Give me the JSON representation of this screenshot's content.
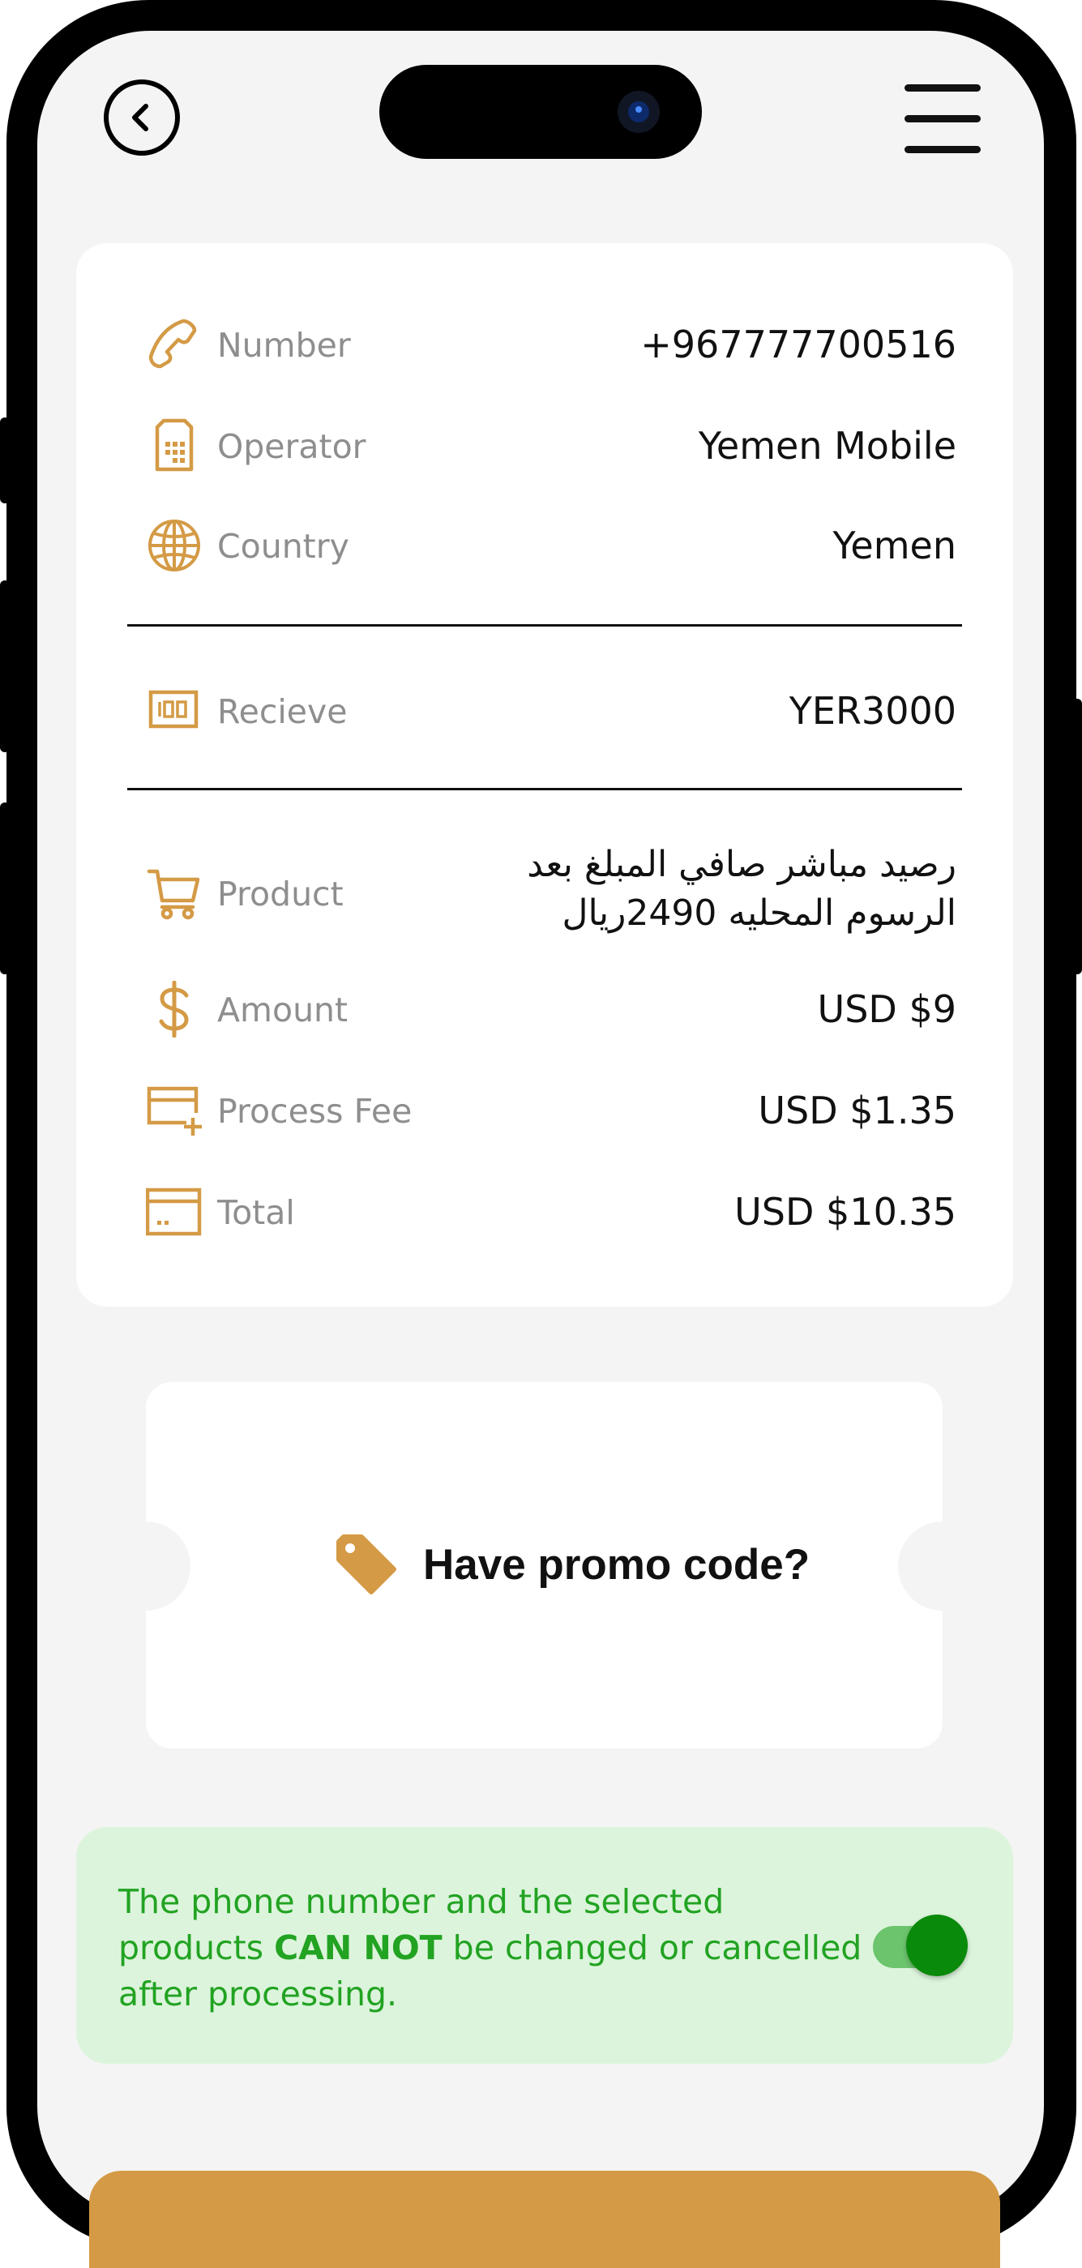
{
  "details": [
    {
      "icon": "phone-icon",
      "label": "Number",
      "value": "+967777700516"
    },
    {
      "icon": "sim-card-icon",
      "label": "Operator",
      "value": "Yemen Mobile"
    },
    {
      "icon": "globe-icon",
      "label": "Country",
      "value": "Yemen"
    }
  ],
  "receive": {
    "icon": "receive-card-icon",
    "label": "Recieve",
    "value": "YER3000"
  },
  "product": {
    "icon": "cart-icon",
    "label": "Product",
    "value": "رصيد مباشر صافي المبلغ بعد الرسوم المحليه 2490ريال"
  },
  "pricing": [
    {
      "icon": "dollar-icon",
      "label": "Amount",
      "value": "USD $9"
    },
    {
      "icon": "card-plus-icon",
      "label": "Process Fee",
      "value": "USD $1.35"
    },
    {
      "icon": "card-icon",
      "label": "Total",
      "value": "USD $10.35"
    }
  ],
  "promo": {
    "label": "Have promo code?",
    "icon": "tag-icon"
  },
  "notice": {
    "text_before": "The phone number and the selected products ",
    "text_bold": "CAN NOT",
    "text_after": " be changed or cancelled after processing.",
    "toggle_on": true
  },
  "colors": {
    "accent": "#d49a45",
    "notice_bg": "#dcf4dc",
    "notice_text": "#22a322",
    "toggle": "#0a8a0a"
  }
}
